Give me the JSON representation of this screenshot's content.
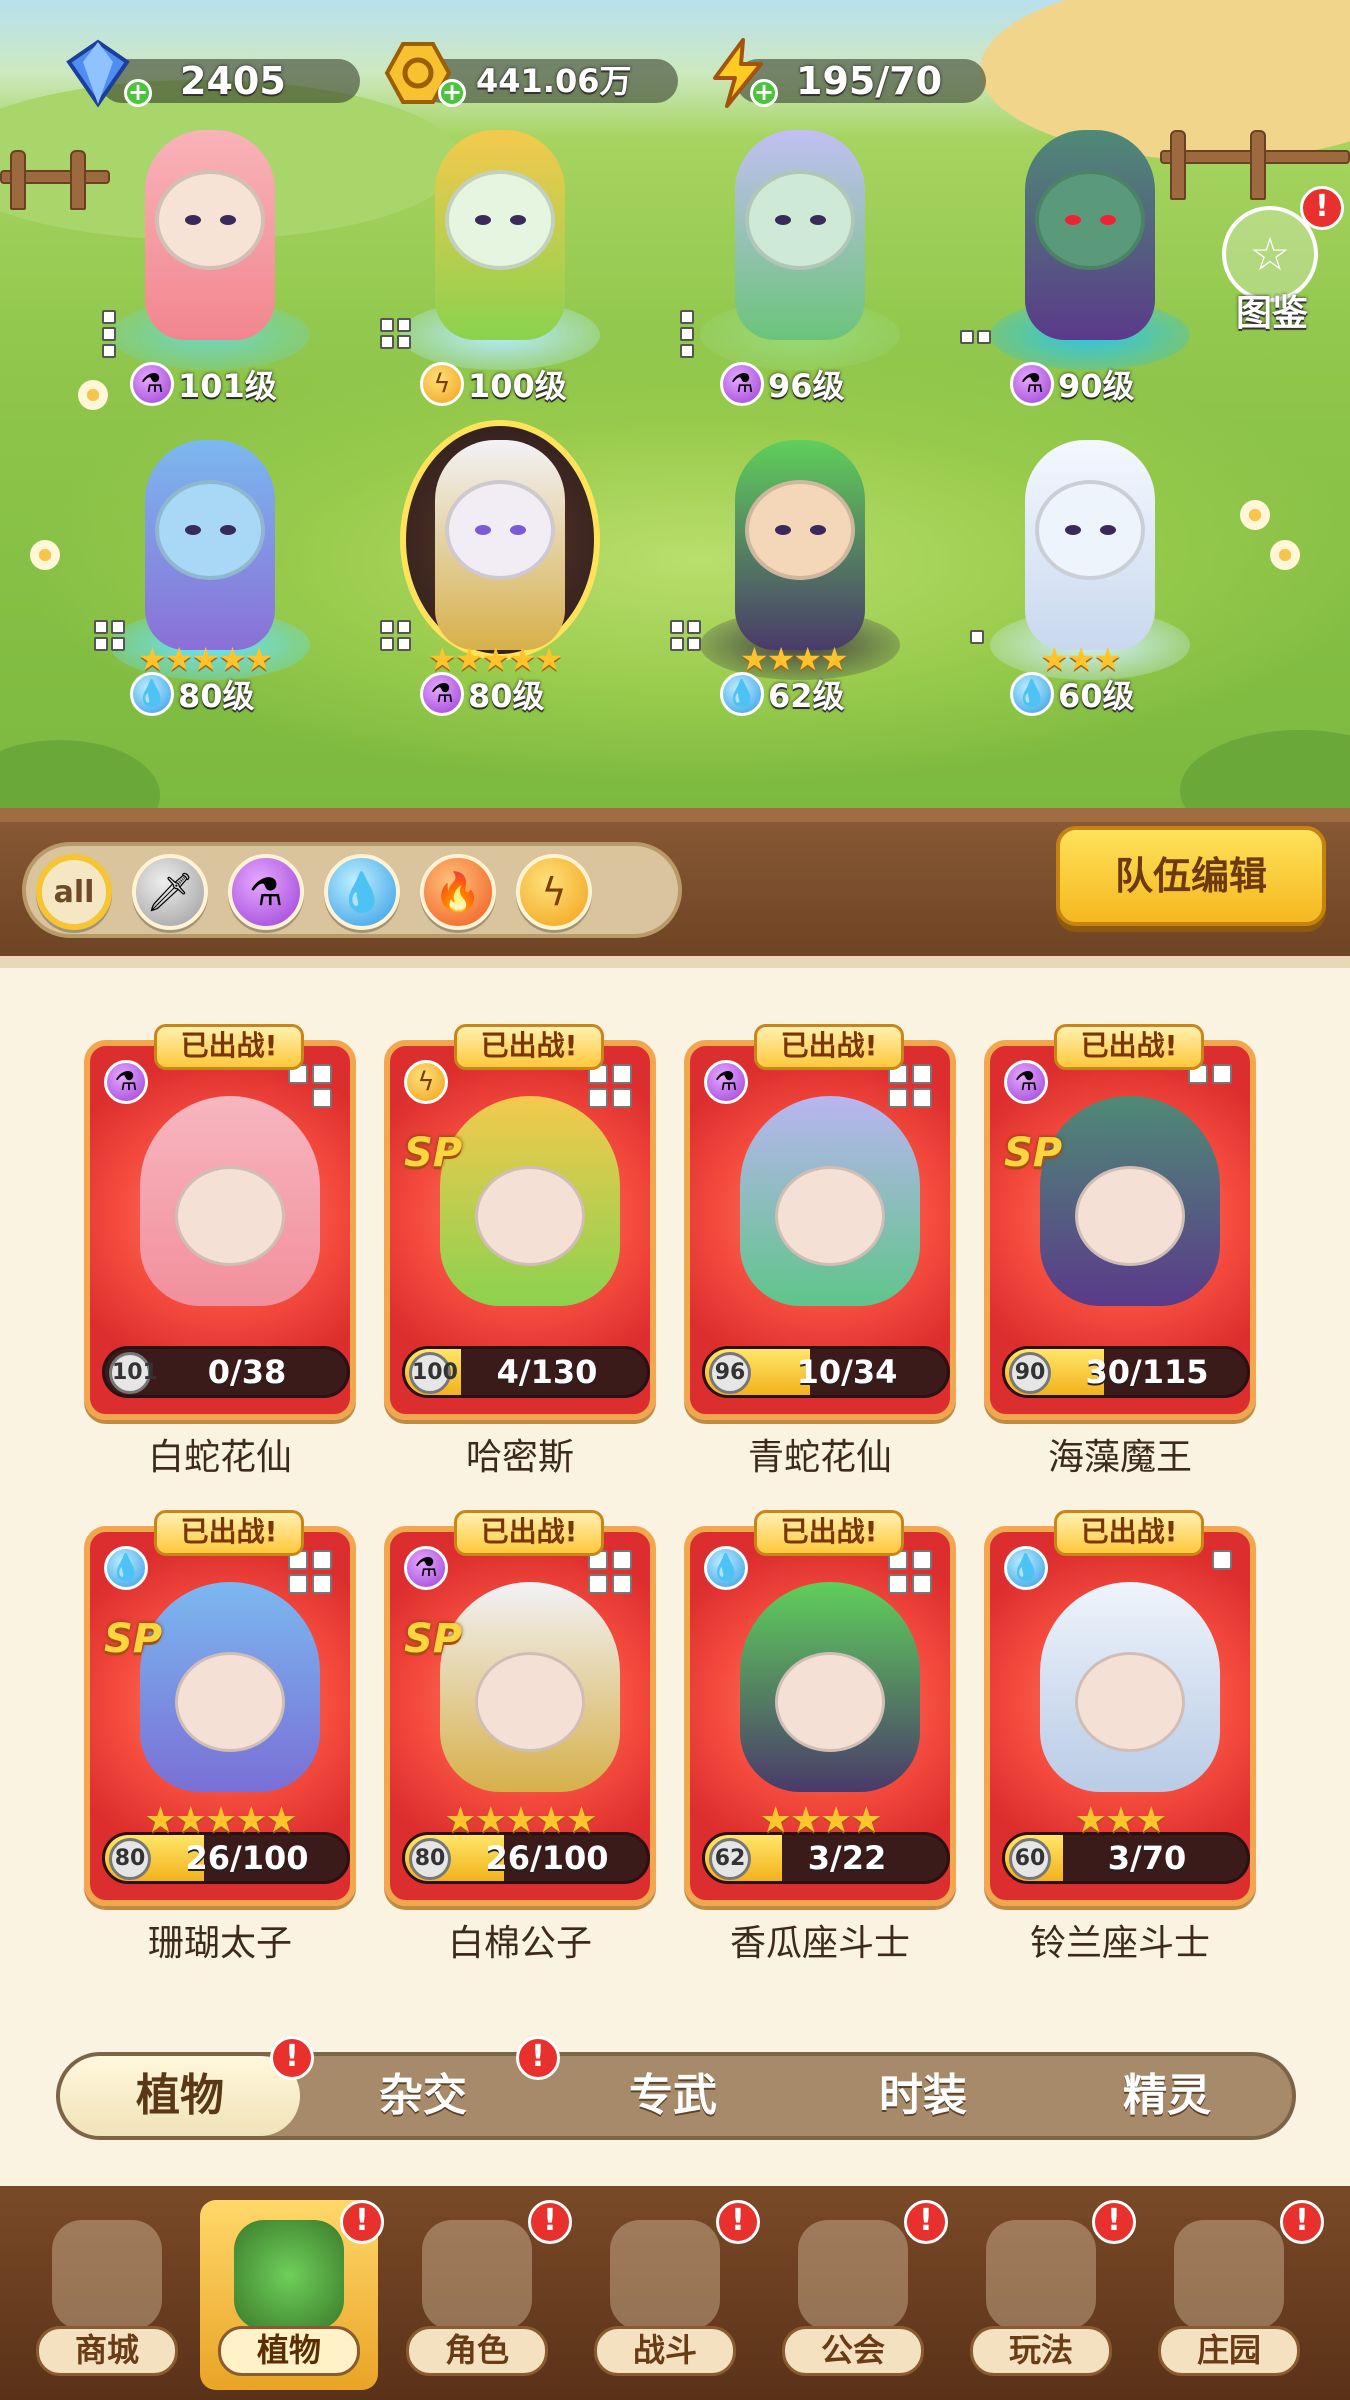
{
  "currencies": {
    "gems": "2405",
    "gold": "441.06万",
    "energy": "195/70"
  },
  "codex_label": "图鉴",
  "formation": [
    {
      "level": "101级",
      "element": "purple-potion-icon",
      "stars": ""
    },
    {
      "level": "100级",
      "element": "lightning-icon",
      "stars": ""
    },
    {
      "level": "96级",
      "element": "purple-potion-icon",
      "stars": ""
    },
    {
      "level": "90级",
      "element": "purple-potion-icon",
      "stars": ""
    },
    {
      "level": "80级",
      "element": "water-drop-icon",
      "stars": "★★★★★"
    },
    {
      "level": "80级",
      "element": "purple-potion-icon",
      "stars": "★★★★★"
    },
    {
      "level": "62级",
      "element": "water-drop-icon",
      "stars": "★★★★"
    },
    {
      "level": "60级",
      "element": "water-drop-icon",
      "stars": "★★★"
    }
  ],
  "filters": {
    "all_label": "all",
    "team_edit_label": "队伍编辑"
  },
  "cards": [
    {
      "tag": "已出战!",
      "name": "白蛇花仙",
      "level": "101",
      "progress": "0/38",
      "progress_fraction": 0.0,
      "sp": "",
      "stars": "",
      "element": "purple-potion-icon"
    },
    {
      "tag": "已出战!",
      "name": "哈密斯",
      "level": "100",
      "progress": "4/130",
      "progress_fraction": 0.03,
      "sp": "SP",
      "stars": "",
      "element": "lightning-icon"
    },
    {
      "tag": "已出战!",
      "name": "青蛇花仙",
      "level": "96",
      "progress": "10/34",
      "progress_fraction": 0.29,
      "sp": "",
      "stars": "",
      "element": "purple-potion-icon"
    },
    {
      "tag": "已出战!",
      "name": "海藻魔王",
      "level": "90",
      "progress": "30/115",
      "progress_fraction": 0.26,
      "sp": "SP",
      "stars": "",
      "element": "purple-potion-icon"
    },
    {
      "tag": "已出战!",
      "name": "珊瑚太子",
      "level": "80",
      "progress": "26/100",
      "progress_fraction": 0.26,
      "sp": "SP",
      "stars": "★★★★★",
      "element": "water-drop-icon"
    },
    {
      "tag": "已出战!",
      "name": "白棉公子",
      "level": "80",
      "progress": "26/100",
      "progress_fraction": 0.26,
      "sp": "SP",
      "stars": "★★★★★",
      "element": "purple-potion-icon"
    },
    {
      "tag": "已出战!",
      "name": "香瓜座斗士",
      "level": "62",
      "progress": "3/22",
      "progress_fraction": 0.14,
      "sp": "",
      "stars": "★★★★",
      "element": "water-drop-icon"
    },
    {
      "tag": "已出战!",
      "name": "铃兰座斗士",
      "level": "60",
      "progress": "3/70",
      "progress_fraction": 0.04,
      "sp": "",
      "stars": "★★★",
      "element": "water-drop-icon"
    }
  ],
  "subtabs": [
    "植物",
    "杂交",
    "专武",
    "时装",
    "精灵"
  ],
  "bottom_nav": [
    "商城",
    "植物",
    "角色",
    "战斗",
    "公会",
    "玩法",
    "庄园"
  ],
  "badge": "!",
  "colors": {
    "accent_gold": "#f5b81f",
    "card_red": "#f44b3e",
    "badge_red": "#e8312c"
  }
}
